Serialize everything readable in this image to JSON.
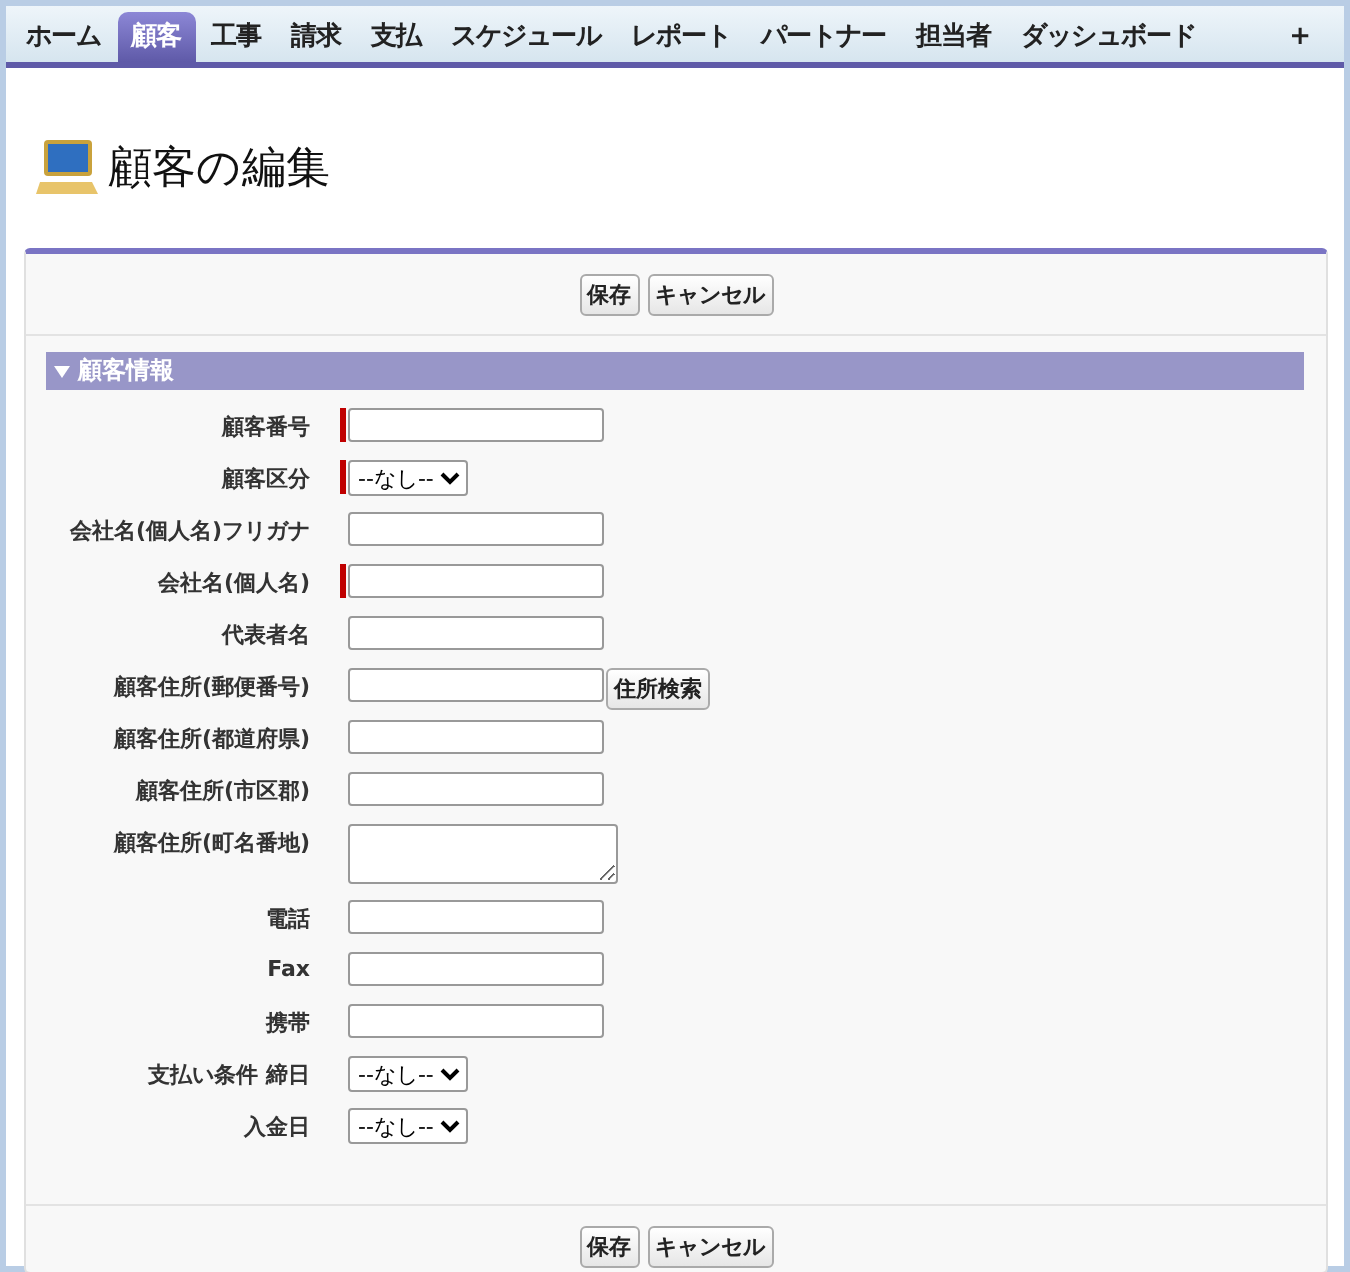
{
  "tabs": [
    {
      "label": "ホーム",
      "selected": false
    },
    {
      "label": "顧客",
      "selected": true
    },
    {
      "label": "工事",
      "selected": false
    },
    {
      "label": "請求",
      "selected": false
    },
    {
      "label": "支払",
      "selected": false
    },
    {
      "label": "スケジュール",
      "selected": false
    },
    {
      "label": "レポート",
      "selected": false
    },
    {
      "label": "パートナー",
      "selected": false
    },
    {
      "label": "担当者",
      "selected": false
    },
    {
      "label": "ダッシュボード",
      "selected": false
    },
    {
      "label": "+",
      "selected": false
    }
  ],
  "page_title": "顧客の編集",
  "top_buttons": [
    "保存",
    "キャンセル"
  ],
  "section": {
    "title": "顧客情報",
    "expanded": true,
    "fields": [
      {
        "label": "顧客番号",
        "kind": "text",
        "required": true
      },
      {
        "label": "顧客区分",
        "kind": "select",
        "required": true,
        "value": "--なし--"
      },
      {
        "label": "会社名(個人名)フリガナ",
        "kind": "text",
        "required": false
      },
      {
        "label": "会社名(個人名)",
        "kind": "text",
        "required": true
      },
      {
        "label": "代表者名",
        "kind": "text",
        "required": false
      },
      {
        "label": "顧客住所(郵便番号)",
        "kind": "text",
        "required": false,
        "button": "住所検索"
      },
      {
        "label": "顧客住所(都道府県)",
        "kind": "text",
        "required": false
      },
      {
        "label": "顧客住所(市区郡)",
        "kind": "text",
        "required": false
      },
      {
        "label": "顧客住所(町名番地)",
        "kind": "textarea",
        "required": false
      },
      {
        "label": "電話",
        "kind": "text",
        "required": false
      },
      {
        "label": "Fax",
        "kind": "text",
        "required": false
      },
      {
        "label": "携帯",
        "kind": "text",
        "required": false
      },
      {
        "label": "支払い条件 締日",
        "kind": "select",
        "required": false,
        "value": "--なし--"
      },
      {
        "label": "入金日",
        "kind": "select",
        "required": false,
        "value": "--なし--  "
      }
    ]
  },
  "bottom_buttons": [
    "保存",
    "キャンセル"
  ]
}
